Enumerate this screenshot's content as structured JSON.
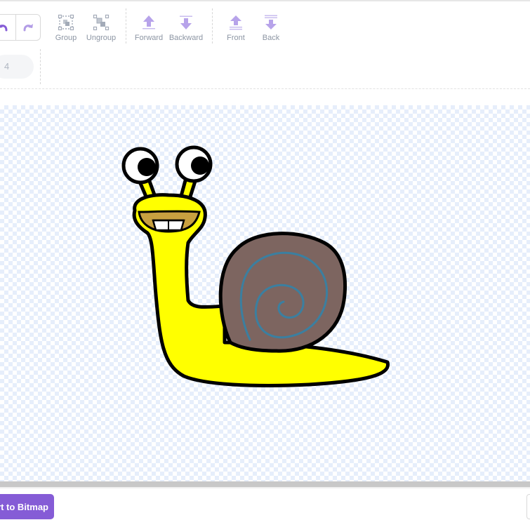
{
  "toolbar": {
    "undo_icon": "undo-icon",
    "redo_icon": "redo-icon",
    "group": {
      "label": "Group",
      "icon": "group-icon"
    },
    "ungroup": {
      "label": "Ungroup",
      "icon": "ungroup-icon"
    },
    "forward": {
      "label": "Forward",
      "icon": "forward-arrow-icon"
    },
    "backward": {
      "label": "Backward",
      "icon": "backward-arrow-icon"
    },
    "front": {
      "label": "Front",
      "icon": "front-arrow-icon"
    },
    "back": {
      "label": "Back",
      "icon": "back-arrow-icon"
    },
    "brush_size_value": "4"
  },
  "canvas": {
    "costume": "snail",
    "colors": {
      "snail_body": "#ffff00",
      "shell": "#7d6560",
      "spiral": "#3b7fa0",
      "outline": "#000000",
      "mouth": "#c8a040",
      "checker": "#e6eefb"
    }
  },
  "footer": {
    "convert_button_label": "rt to Bitmap",
    "accent": "#855cd6"
  }
}
